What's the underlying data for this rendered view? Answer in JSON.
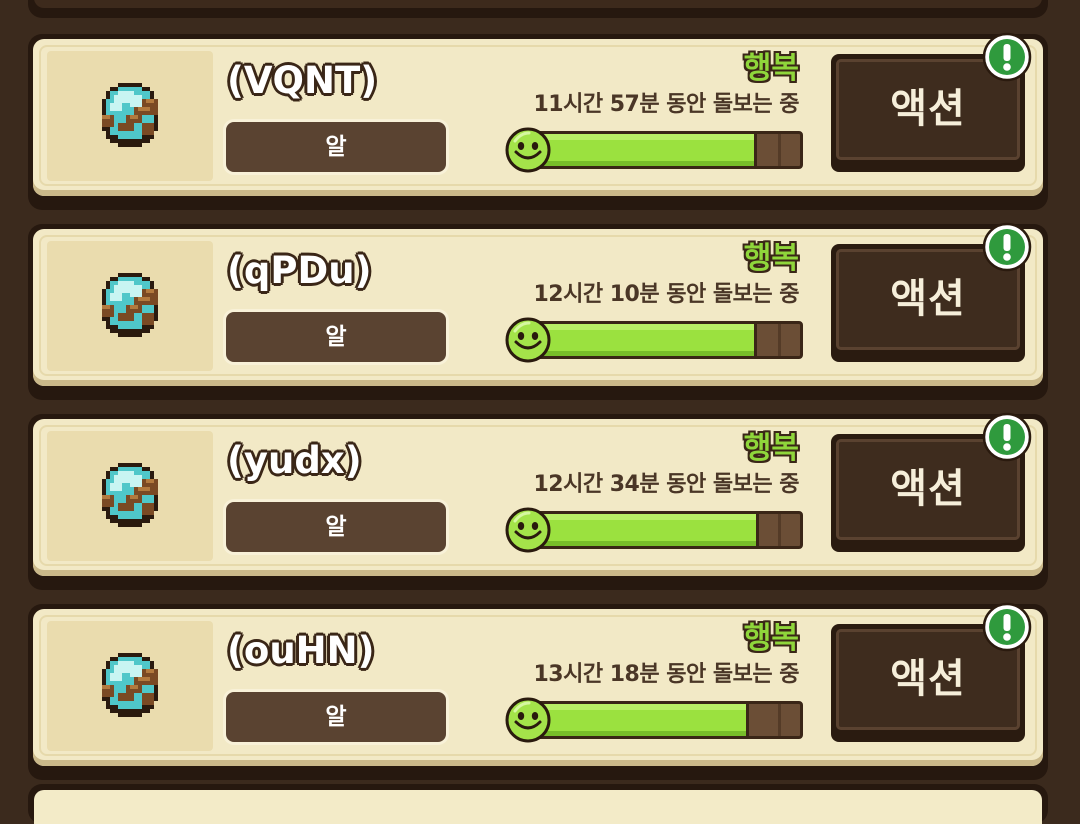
{
  "pets": [
    {
      "name": "(VQNT)",
      "stage": "알",
      "mood": "행복",
      "care_time": "11시간 57분 동안 돌보는 중",
      "mood_level": 0.83,
      "action_label": "액션",
      "notification": "!"
    },
    {
      "name": "(qPDu)",
      "stage": "알",
      "mood": "행복",
      "care_time": "12시간 10분 동안 돌보는 중",
      "mood_level": 0.83,
      "action_label": "액션",
      "notification": "!"
    },
    {
      "name": "(yudx)",
      "stage": "알",
      "mood": "행복",
      "care_time": "12시간 34분 동안 돌보는 중",
      "mood_level": 0.84,
      "action_label": "액션",
      "notification": "!"
    },
    {
      "name": "(ouHN)",
      "stage": "알",
      "mood": "행복",
      "care_time": "13시간 18분 동안 돌보는 중",
      "mood_level": 0.8,
      "action_label": "액션",
      "notification": "!"
    }
  ],
  "colors": {
    "mood_happy": "#8fd63b",
    "bar_fill": "#9be13f",
    "card_bg": "#f2e9c6",
    "frame": "#26180f",
    "badge_green": "#2f9a3d"
  },
  "icons": {
    "pet": "egg-icon",
    "mood": "smiley-icon",
    "notification": "exclamation-icon"
  }
}
